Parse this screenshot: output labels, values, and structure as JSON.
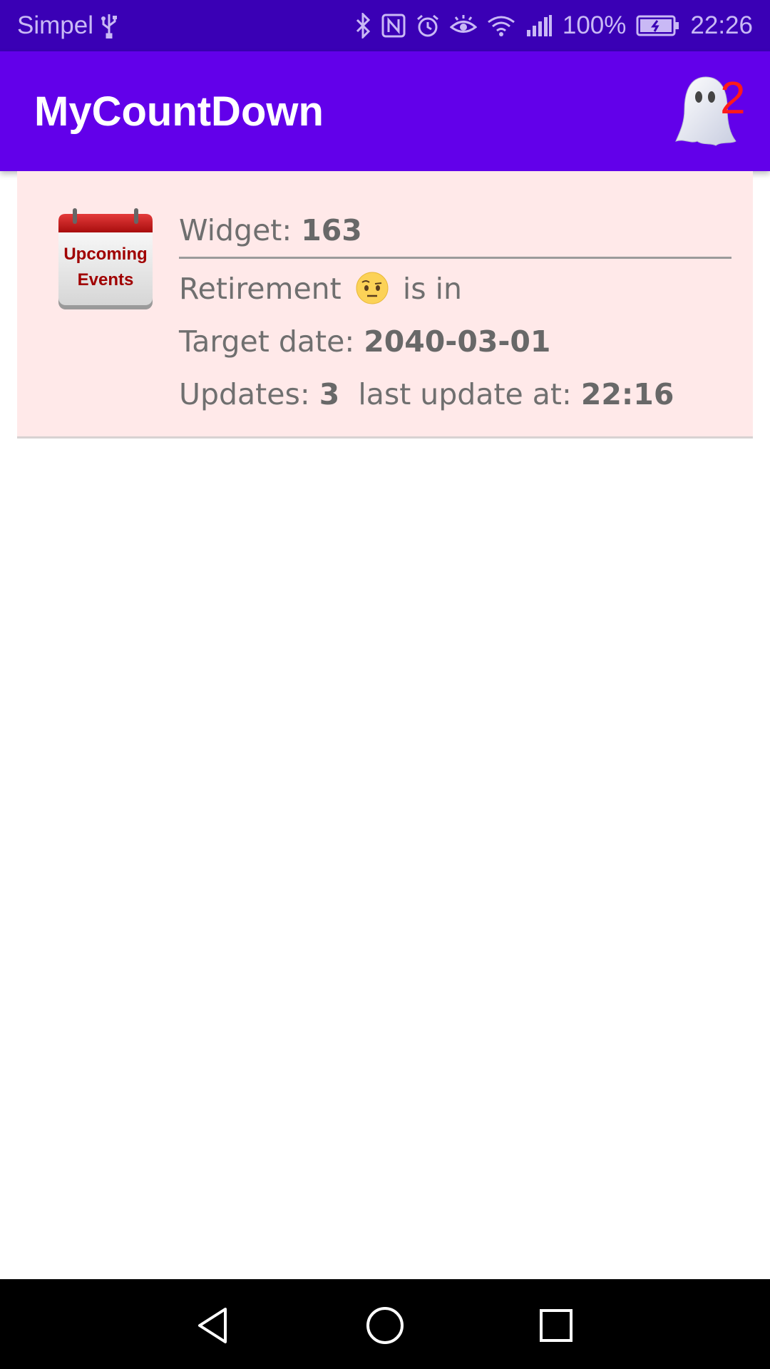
{
  "status_bar": {
    "carrier": "Simpel",
    "battery": "100%",
    "time": "22:26",
    "icons": [
      "usb-icon",
      "bluetooth-icon",
      "nfc-icon",
      "alarm-icon",
      "eye-comfort-icon",
      "wifi-icon",
      "signal-icon",
      "battery-charging-icon"
    ]
  },
  "app_bar": {
    "title": "MyCountDown",
    "ghost_count": "2",
    "color": "#6200ea"
  },
  "event": {
    "icon_label_line1": "Upcoming",
    "icon_label_line2": "Events",
    "widget_label": "Widget: ",
    "widget_id": "163",
    "event_name": "Retirement",
    "emoji": "face-with-raised-eyebrow",
    "is_in": "is in",
    "target_label": "Target date: ",
    "target_date": "2040-03-01",
    "updates_label": "Updates: ",
    "updates_count": "3",
    "last_update_label": "last update at: ",
    "last_update_time": "22:16",
    "card_color": "#ffe9e9"
  },
  "nav_bar": {
    "buttons": [
      "back-icon",
      "home-icon",
      "recents-icon"
    ]
  }
}
